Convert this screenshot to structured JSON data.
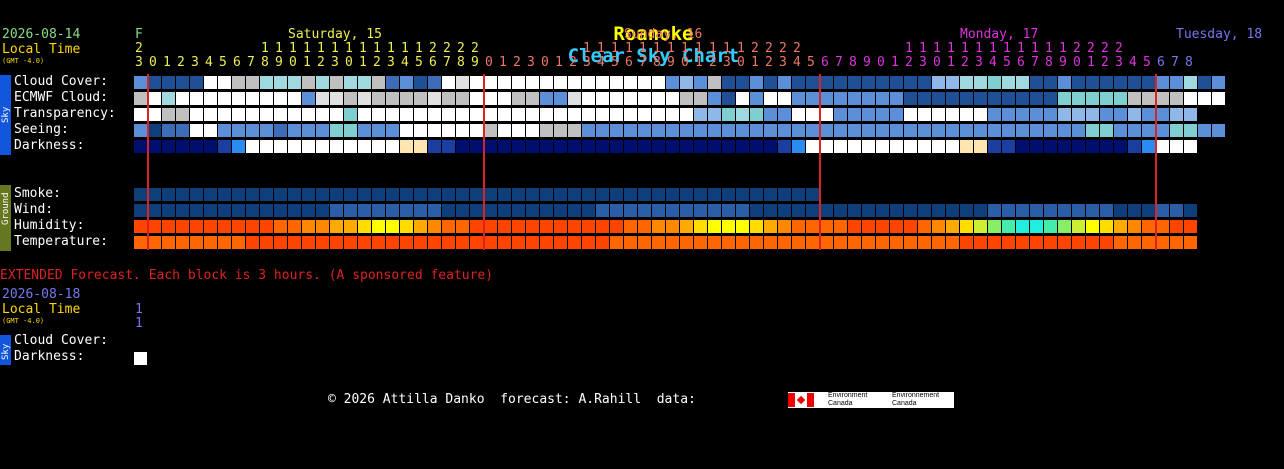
{
  "title_part1": "Roanoke",
  "title_part2": "Clear Sky Chart",
  "header": {
    "date": "2026-08-14",
    "local_time": "Local Time",
    "gmt": "(GMT -4.0)",
    "day0_letter": "F",
    "day0_digit": "2",
    "days": [
      {
        "label": "Saturday, 15",
        "color": "#eeee55"
      },
      {
        "label": "Sunday, 16",
        "color": "#ee7766"
      },
      {
        "label": "Monday, 17",
        "color": "#dd33dd"
      },
      {
        "label": "Tuesday, 18",
        "color": "#7777ee"
      }
    ],
    "hours_row1": "         1111111111112222       1111111111112222       1111111111112222",
    "hours_row2": "3012345678901230123456789012301234567890123012345678901230123456789012345678"
  },
  "rows": {
    "sky": [
      "Cloud Cover:",
      "ECMWF Cloud:",
      "Transparency:",
      "Seeing:",
      "Darkness:"
    ],
    "ground": [
      "Smoke:",
      "Wind:",
      "Humidity:",
      "Temperature:"
    ]
  },
  "sidebar": {
    "sky": "Sky",
    "ground": "Ground"
  },
  "extended": {
    "note": "EXTENDED Forecast. Each block is 3 hours. (A sponsored feature)",
    "date": "2026-08-18",
    "local_time": "Local Time",
    "gmt": "(GMT -4.0)",
    "hour1": "1",
    "hour2": "1",
    "rows": [
      "Cloud Cover:",
      "Darkness:"
    ]
  },
  "footer": {
    "copyright": "© 2026 Attilla Danko  forecast: A.Rahill  data:",
    "logo_en": "Environment Canada",
    "logo_fr": "Environnement Canada"
  },
  "chart_data": {
    "type": "heatmap",
    "columns": 76,
    "day_separator_columns": [
      1,
      25,
      49,
      73
    ],
    "colors": {
      "cloud_scale": [
        "#ffffff",
        "#e0e0e0",
        "#c0c0c0",
        "#a0d8e0",
        "#7fcfd0",
        "#8fb8e8",
        "#5b8fd8",
        "#3d6cb8",
        "#1f4f94",
        "#0e3f7a"
      ],
      "night": "#000e6e",
      "deep_night": "#000060",
      "twilight": [
        "#1a3fa0",
        "#1e5fd0",
        "#2a8bf0",
        "#6cb4f8",
        "#ffe5b0",
        "#ffffff"
      ],
      "temp_scale": [
        "#ff2200",
        "#ff4400",
        "#ff6600",
        "#ff8800",
        "#ffaa00",
        "#ffdd00",
        "#ffff00",
        "#ccee33",
        "#88ee66",
        "#44eeaa",
        "#22eedd",
        "#00ddee"
      ],
      "separator": "#dd2222"
    },
    "series": [
      {
        "name": "Cloud Cover:",
        "values": [
          6,
          8,
          8,
          8,
          8,
          0,
          0,
          2,
          2,
          3,
          3,
          3,
          2,
          3,
          2,
          3,
          3,
          2,
          7,
          6,
          8,
          7,
          0,
          1,
          0,
          0,
          0,
          0,
          0,
          0,
          0,
          0,
          0,
          0,
          0,
          0,
          0,
          0,
          6,
          5,
          6,
          2,
          8,
          8,
          6,
          8,
          6,
          8,
          8,
          8,
          8,
          8,
          8,
          8,
          8,
          8,
          8,
          5,
          5,
          3,
          3,
          4,
          3,
          3,
          8,
          8,
          6,
          8,
          8,
          8,
          8,
          8,
          8,
          6,
          6,
          3,
          8,
          6
        ]
      },
      {
        "name": "ECMWF Cloud:",
        "values": [
          2,
          0,
          3,
          0,
          0,
          0,
          0,
          0,
          0,
          0,
          0,
          0,
          6,
          1,
          1,
          2,
          1,
          2,
          2,
          2,
          2,
          1,
          2,
          2,
          0,
          0,
          0,
          2,
          2,
          6,
          6,
          1,
          0,
          0,
          0,
          0,
          0,
          0,
          0,
          2,
          2,
          6,
          8,
          0,
          6,
          0,
          0,
          6,
          6,
          6,
          6,
          6,
          6,
          6,
          6,
          8,
          8,
          8,
          8,
          8,
          8,
          8,
          8,
          8,
          8,
          8,
          4,
          4,
          4,
          4,
          4,
          2,
          2,
          2,
          2,
          0,
          0,
          0
        ]
      },
      {
        "name": "Transparency:",
        "values": [
          0,
          0,
          2,
          2,
          0,
          0,
          0,
          0,
          0,
          0,
          0,
          0,
          0,
          0,
          0,
          4,
          0,
          0,
          0,
          0,
          0,
          0,
          0,
          0,
          0,
          0,
          0,
          0,
          0,
          0,
          0,
          0,
          0,
          0,
          0,
          0,
          0,
          0,
          0,
          0,
          5,
          5,
          4,
          3,
          4,
          6,
          6,
          0,
          0,
          0,
          6,
          6,
          6,
          6,
          6,
          0,
          0,
          0,
          0,
          0,
          0,
          6,
          6,
          6,
          6,
          6,
          5,
          5,
          5,
          6,
          6,
          5,
          6,
          6,
          5,
          5
        ]
      },
      {
        "name": "Seeing:",
        "values": [
          6,
          9,
          7,
          7,
          0,
          0,
          6,
          6,
          6,
          6,
          7,
          6,
          6,
          6,
          4,
          4,
          6,
          6,
          6,
          0,
          0,
          0,
          0,
          0,
          0,
          2,
          0,
          0,
          0,
          2,
          2,
          2,
          6,
          6,
          6,
          6,
          6,
          6,
          6,
          6,
          6,
          6,
          6,
          6,
          6,
          6,
          6,
          6,
          6,
          6,
          6,
          6,
          6,
          6,
          6,
          6,
          6,
          6,
          6,
          6,
          6,
          6,
          6,
          6,
          6,
          6,
          6,
          6,
          4,
          4,
          6,
          6,
          6,
          6,
          4,
          4,
          6,
          6
        ]
      },
      {
        "name": "Darkness:",
        "values": [
          9,
          9,
          9,
          9,
          9,
          9,
          3,
          4,
          5,
          5,
          5,
          5,
          5,
          5,
          5,
          5,
          5,
          5,
          5,
          6,
          6,
          3,
          3,
          9,
          9,
          9,
          9,
          9,
          9,
          9,
          9,
          9,
          9,
          9,
          9,
          9,
          9,
          9,
          9,
          9,
          9,
          9,
          9,
          9,
          9,
          9,
          3,
          4,
          5,
          5,
          5,
          5,
          5,
          5,
          5,
          5,
          5,
          5,
          5,
          6,
          6,
          3,
          3,
          9,
          9,
          9,
          9,
          9,
          9,
          9,
          9,
          3,
          4,
          5,
          5,
          5
        ]
      },
      {
        "name": "Smoke:",
        "values": [
          9,
          9,
          9,
          9,
          9,
          9,
          9,
          9,
          9,
          9,
          9,
          9,
          9,
          9,
          9,
          9,
          9,
          9,
          9,
          9,
          9,
          9,
          9,
          9,
          9,
          9,
          9,
          9,
          9,
          9,
          9,
          9,
          9,
          9,
          9,
          9,
          9,
          9,
          9,
          9,
          9,
          9,
          9,
          9,
          9,
          9,
          9,
          9,
          9
        ]
      },
      {
        "name": "Wind:",
        "values": [
          9,
          9,
          9,
          9,
          9,
          9,
          9,
          9,
          9,
          9,
          9,
          9,
          9,
          9,
          8,
          8,
          8,
          8,
          8,
          8,
          8,
          8,
          9,
          9,
          9,
          9,
          9,
          9,
          9,
          9,
          9,
          9,
          9,
          8,
          8,
          8,
          8,
          8,
          8,
          8,
          8,
          8,
          8,
          8,
          9,
          9,
          9,
          9,
          9,
          9,
          9,
          9,
          9,
          9,
          9,
          9,
          9,
          9,
          9,
          9,
          9,
          8,
          8,
          8,
          8,
          8,
          8,
          8,
          8,
          8,
          9,
          9,
          9,
          8,
          8,
          9
        ]
      },
      {
        "name": "Humidity:",
        "values": [
          1,
          1,
          1,
          1,
          1,
          1,
          1,
          1,
          1,
          1,
          2,
          2,
          3,
          3,
          4,
          4,
          5,
          6,
          6,
          5,
          4,
          3,
          2,
          2,
          1,
          1,
          1,
          1,
          1,
          1,
          1,
          1,
          1,
          1,
          1,
          2,
          2,
          3,
          3,
          4,
          5,
          6,
          6,
          6,
          5,
          4,
          3,
          2,
          2,
          2,
          2,
          1,
          1,
          1,
          1,
          1,
          2,
          3,
          4,
          5,
          7,
          8,
          9,
          10,
          10,
          9,
          8,
          7,
          6,
          5,
          4,
          3,
          2,
          2,
          1,
          1
        ]
      },
      {
        "name": "Temperature:",
        "values": [
          2,
          2,
          2,
          2,
          2,
          2,
          2,
          2,
          1,
          1,
          1,
          1,
          1,
          1,
          1,
          1,
          1,
          1,
          1,
          1,
          1,
          1,
          1,
          1,
          1,
          1,
          1,
          1,
          1,
          1,
          1,
          1,
          1,
          1,
          2,
          2,
          2,
          2,
          2,
          2,
          2,
          2,
          2,
          2,
          2,
          2,
          2,
          2,
          2,
          2,
          2,
          2,
          2,
          2,
          2,
          2,
          2,
          2,
          2,
          1,
          1,
          1,
          1,
          1,
          1,
          1,
          1,
          1,
          1,
          1,
          2,
          2,
          2,
          2,
          2,
          2
        ]
      }
    ],
    "extended": {
      "Cloud Cover:": [],
      "Darkness:": [
        5
      ]
    }
  }
}
